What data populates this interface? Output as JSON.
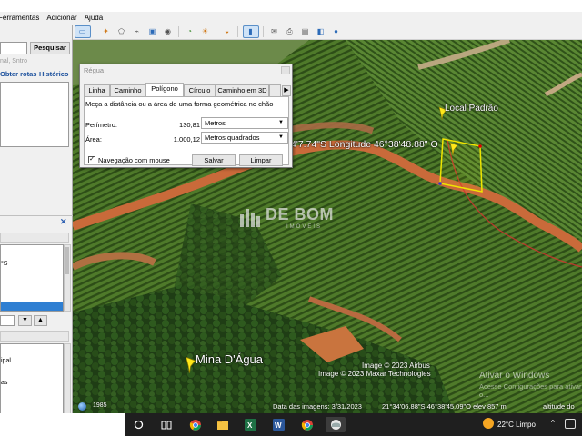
{
  "menu": {
    "items": [
      "Ferramentas",
      "Adicionar",
      "Ajuda"
    ]
  },
  "toolbar": {
    "buttons": [
      "sidebar-toggle-icon",
      "placemark-icon",
      "polygon-icon",
      "path-icon",
      "image-overlay-icon",
      "tour-icon",
      "historical-imagery-icon",
      "sunlight-icon",
      "planets-icon",
      "ruler-icon",
      "email-icon",
      "print-icon",
      "save-image-icon",
      "maps-icon",
      "earth-icon"
    ]
  },
  "sidebar": {
    "search_button": "Pesquisar",
    "search_hint": "nal, Sntro",
    "link_routes": "Obter rotas",
    "link_history": "Histórico",
    "tree_coord_text": "°S",
    "layer_items": [
      "ipal",
      "as"
    ]
  },
  "ruler": {
    "title": "Régua",
    "tabs": [
      "Linha",
      "Caminho",
      "Polígono",
      "Círculo",
      "Caminho em 3D"
    ],
    "active_tab": "Polígono",
    "description": "Meça a distância ou a área de uma forma geométrica no chão",
    "perimeter_label": "Perímetro:",
    "perimeter_value": "130,81",
    "perimeter_unit": "Metros",
    "area_label": "Área:",
    "area_value": "1.000,12",
    "area_unit": "Metros quadrados",
    "mouse_nav_label": "Navegação com mouse",
    "mouse_nav_checked": true,
    "save_label": "Salvar",
    "clear_label": "Limpar"
  },
  "map": {
    "label_local": "Local Padrão",
    "label_mina": "Mina D'Água",
    "label_coord": "4'7.74\"S Longitude  46°38'48.88\" O",
    "watermark": "DE BOM",
    "watermark_sub": "IMÓVEIS",
    "credit_1": "Image © 2023 Airbus",
    "credit_2": "Image © 2023 Maxar Technologies",
    "activate_1": "Ativar o Windows",
    "activate_2": "Acesse Configurações para ativar o...",
    "year": "1985",
    "imagery_date": "Data das imagens: 3/31/2023",
    "coords": "21°34'06.88\"S   46°38'45.09\"O   elev   857 m",
    "altitude": "altitude do p..."
  },
  "taskbar": {
    "apps": [
      "start-button",
      "task-view-icon",
      "chrome-icon",
      "file-explorer-icon",
      "excel-icon",
      "word-icon",
      "chrome-profile-icon",
      "google-earth-icon"
    ],
    "weather": "22°C  Limpo"
  }
}
